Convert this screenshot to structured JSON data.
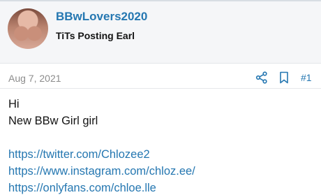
{
  "post": {
    "username": "BBwLovers2020",
    "user_title": "TiTs Posting Earl",
    "date": "Aug 7, 2021",
    "post_number": "#1",
    "body_lines": [
      "Hi",
      "New BBw Girl girl"
    ],
    "links": [
      "https://twitter.com/Chlozee2",
      "https://www.instagram.com/chloz.ee/",
      "https://onlyfans.com/chloe.lle"
    ]
  },
  "icons": {
    "share": "share-icon",
    "bookmark": "bookmark-icon"
  },
  "colors": {
    "link": "#2577b1",
    "text": "#141414",
    "muted": "#8c8c8c",
    "header_bg": "#f5f6f8"
  }
}
